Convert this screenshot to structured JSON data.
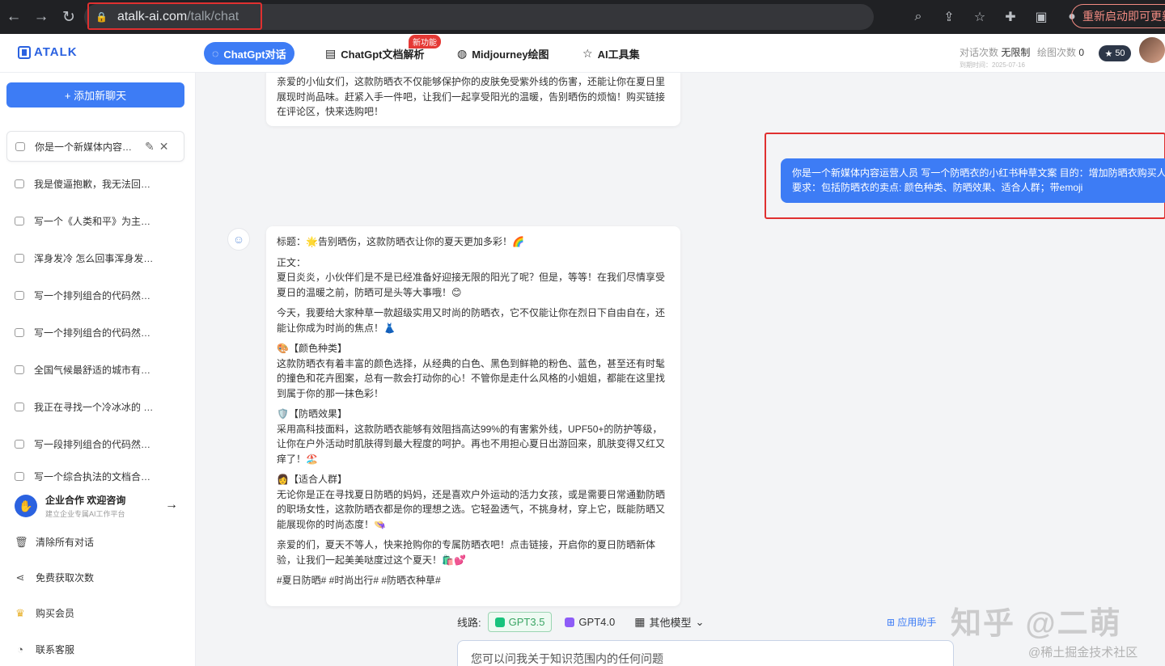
{
  "browser": {
    "url_host": "atalk-ai.com",
    "url_path": "/talk/chat",
    "update_label": "重新启动即可更新"
  },
  "header": {
    "logo": "ATALK",
    "tabs": [
      {
        "label": "ChatGpt对话"
      },
      {
        "label": "ChatGpt文档解析"
      },
      {
        "label": "Midjourney绘图"
      },
      {
        "label": "AI工具集"
      }
    ],
    "new_badge": "新功能",
    "quota_label": "对话次数",
    "quota_value": "无限制",
    "expire": "到期时间：2025-07-16",
    "draw_label": "绘图次数",
    "draw_value": "0",
    "stars": "50"
  },
  "sidebar": {
    "add_label": "+ 添加新聊天",
    "chats": [
      {
        "title": "你是一个新媒体内容运营人员 写一个防晒衣的小红书种草文案"
      },
      {
        "title": "我是傻逼抱歉，我无法回应这种言论"
      },
      {
        "title": "写一个《人类和平》为主题的论文大纲"
      },
      {
        "title": "浑身发冷 怎么回事浑身发冷可能是什么原因"
      },
      {
        "title": "写一个排列组合的代码然可以！以下是代码"
      },
      {
        "title": "写一个排列组合的代码然可以！以下是代码"
      },
      {
        "title": "全国气候最舒适的城市有哪些国内的城市"
      },
      {
        "title": "我正在寻找一个冷冰冰的 DM 想法"
      },
      {
        "title": "写一段排列组合的代码然可以！以下是代码"
      },
      {
        "title": "写一个综合执法的文档合执法是什么"
      }
    ],
    "enterprise_title": "企业合作 欢迎咨询",
    "enterprise_sub": "建立企业专属AI工作平台",
    "links": [
      {
        "label": "清除所有对话"
      },
      {
        "label": "免费获取次数"
      },
      {
        "label": "购买会员"
      },
      {
        "label": "联系客服"
      }
    ]
  },
  "chat": {
    "prev_reply": "亲爱的小仙女们，这款防晒衣不仅能够保护你的皮肤免受紫外线的伤害，还能让你在夏日里展现时尚品味。赶紧入手一件吧，让我们一起享受阳光的温暖，告别晒伤的烦恼！购买链接在评论区，快来选购吧！",
    "user_line1": "你是一个新媒体内容运营人员 写一个防晒衣的小红书种草文案 目的：增加防晒衣购买人群",
    "user_line2": "要求：包括防晒衣的卖点: 颜色种类、防晒效果、适合人群；带emoji",
    "reply": [
      "标题：🌟告别晒伤，这款防晒衣让你的夏天更加多彩！🌈",
      "正文：\n夏日炎炎，小伙伴们是不是已经准备好迎接无限的阳光了呢？但是，等等！在我们尽情享受夏日的温暖之前，防晒可是头等大事哦！😊",
      "今天，我要给大家种草一款超级实用又时尚的防晒衣，它不仅能让你在烈日下自由自在，还能让你成为时尚的焦点！👗",
      "🎨【颜色种类】\n这款防晒衣有着丰富的颜色选择，从经典的白色、黑色到鲜艳的粉色、蓝色，甚至还有时髦的撞色和花卉图案，总有一款会打动你的心！不管你是走什么风格的小姐姐，都能在这里找到属于你的那一抹色彩！",
      "🛡️【防晒效果】\n采用高科技面料，这款防晒衣能够有效阻挡高达99%的有害紫外线，UPF50+的防护等级，让你在户外活动时肌肤得到最大程度的呵护。再也不用担心夏日出游回来，肌肤变得又红又痒了！🏖️",
      "👩【适合人群】\n无论你是正在寻找夏日防晒的妈妈，还是喜欢户外运动的活力女孩，或是需要日常通勤防晒的职场女性，这款防晒衣都是你的理想之选。它轻盈透气，不挑身材，穿上它，既能防晒又能展现你的时尚态度！👒",
      "亲爱的们，夏天不等人，快来抢购你的专属防晒衣吧！点击链接，开启你的夏日防晒新体验，让我们一起美美哒度过这个夏天！🛍️💕",
      "#夏日防晒# #时尚出行# #防晒衣种草#"
    ]
  },
  "footer": {
    "route_label": "线路:",
    "models": [
      {
        "label": "GPT3.5"
      },
      {
        "label": "GPT4.0"
      },
      {
        "label": "其他模型"
      }
    ],
    "app_help": "应用助手",
    "input_placeholder": "您可以问我关于知识范围内的任何问题"
  },
  "watermarks": {
    "zhihu": "知乎 @二萌",
    "juejin": "@稀土掘金技术社区"
  }
}
